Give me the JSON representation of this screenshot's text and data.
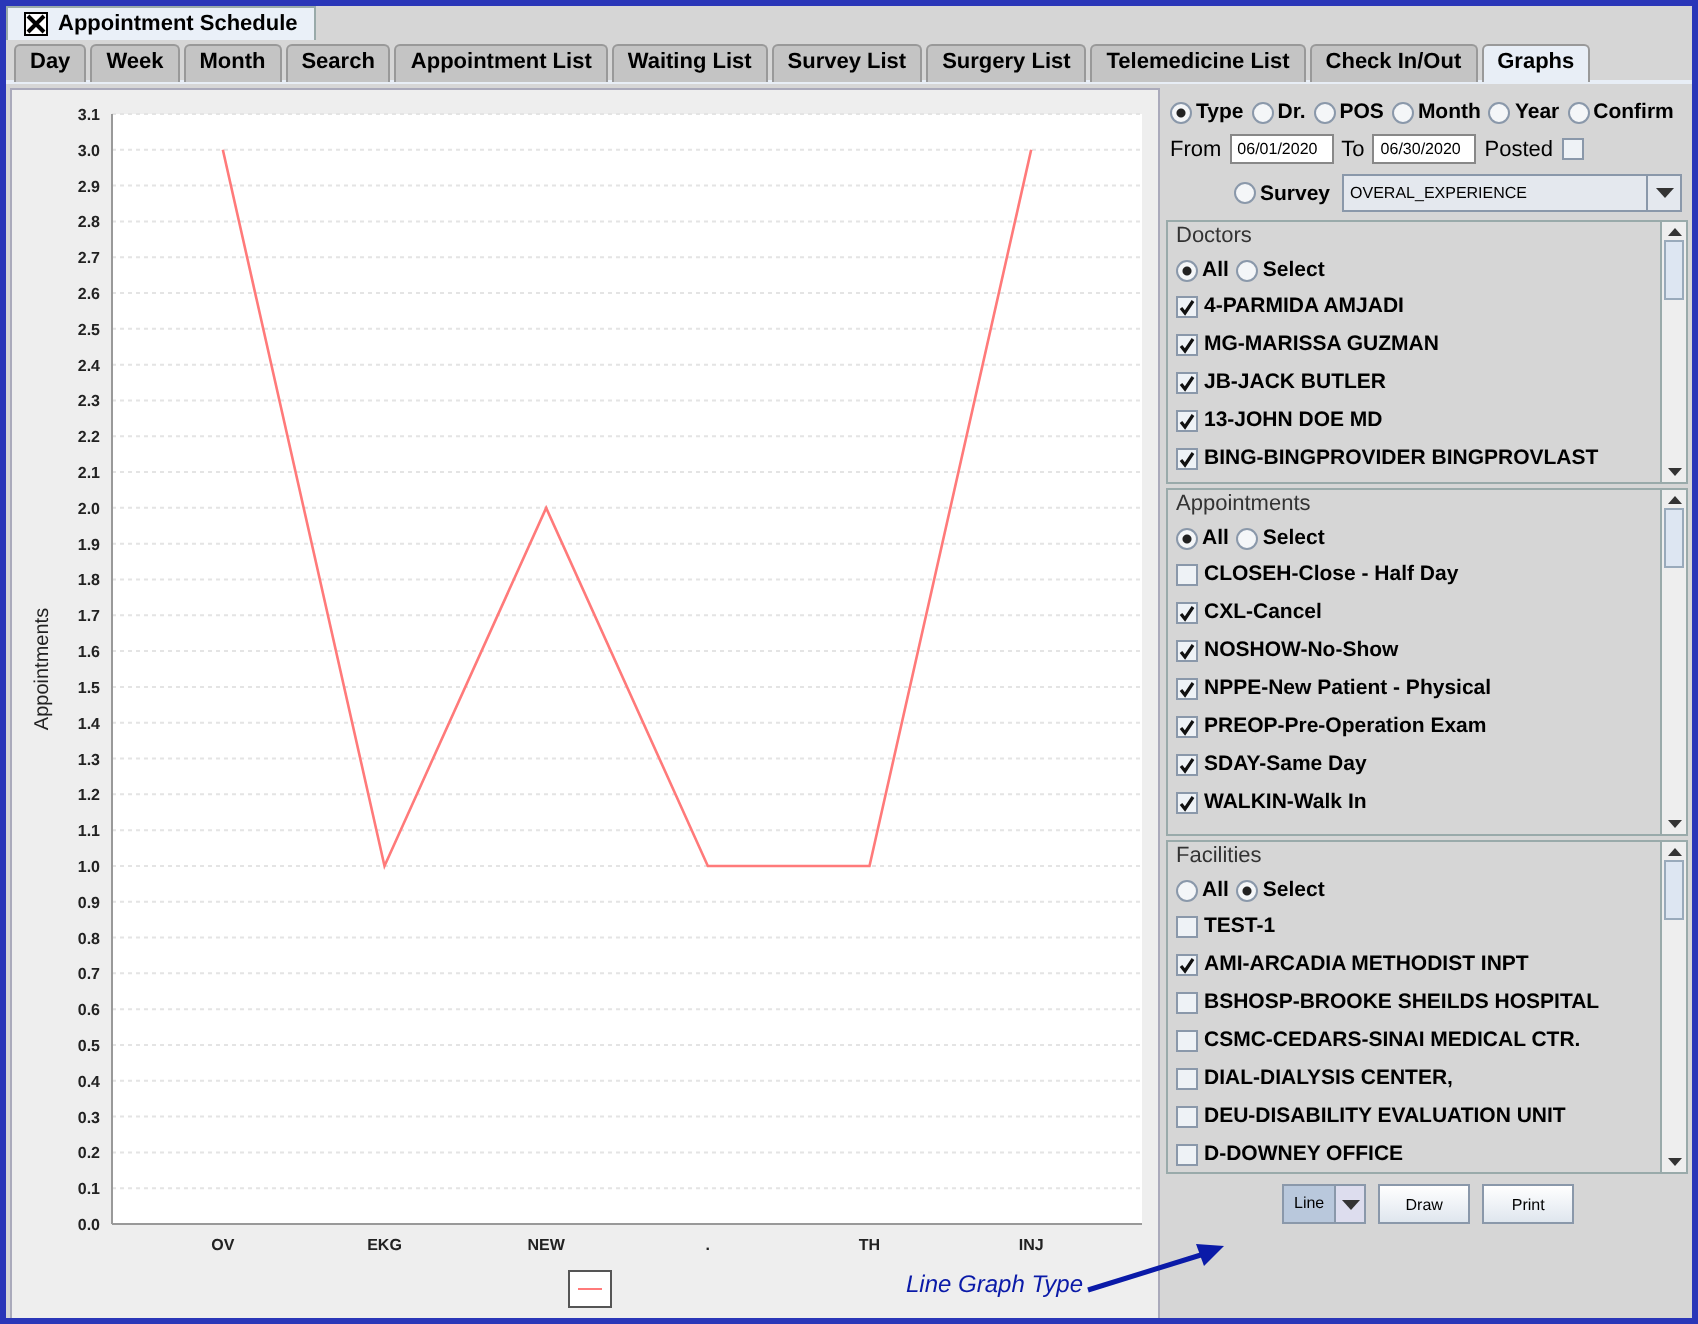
{
  "window": {
    "title": "Appointment Schedule"
  },
  "tabs": [
    {
      "label": "Day",
      "selected": false
    },
    {
      "label": "Week",
      "selected": false
    },
    {
      "label": "Month",
      "selected": false
    },
    {
      "label": "Search",
      "selected": false
    },
    {
      "label": "Appointment List",
      "selected": false
    },
    {
      "label": "Waiting List",
      "selected": false
    },
    {
      "label": "Survey List",
      "selected": false
    },
    {
      "label": "Surgery List",
      "selected": false
    },
    {
      "label": "Telemedicine List",
      "selected": false
    },
    {
      "label": "Check In/Out",
      "selected": false
    },
    {
      "label": "Graphs",
      "selected": true
    }
  ],
  "chart": {
    "chart_data": {
      "type": "line",
      "ylabel": "Appointments",
      "categories": [
        "OV",
        "EKG",
        "NEW",
        ".",
        "TH",
        "INJ"
      ],
      "series": [
        {
          "color": "#ff7a7a",
          "values": [
            3,
            1,
            2,
            1,
            1,
            3
          ]
        }
      ],
      "ylim": [
        0,
        3.1
      ],
      "grid": true,
      "yticks": [
        {
          "value": 0,
          "label": "0.0"
        },
        0.1,
        0.2,
        0.3,
        0.4,
        0.5,
        0.6,
        0.7,
        0.8,
        0.9,
        {
          "value": 1,
          "label": "1.0"
        },
        1.1,
        1.2,
        1.3,
        1.4,
        1.5,
        1.6,
        1.7,
        1.8,
        1.9,
        {
          "value": 2,
          "label": "2.0"
        },
        2.1,
        2.2,
        2.3,
        2.4,
        2.5,
        2.6,
        2.7,
        2.8,
        2.9,
        {
          "value": 3,
          "label": "3.0"
        },
        3.1
      ]
    }
  },
  "controls": {
    "group_by": [
      {
        "label": "Type",
        "selected": true
      },
      {
        "label": "Dr.",
        "selected": false
      },
      {
        "label": "POS",
        "selected": false
      },
      {
        "label": "Month",
        "selected": false
      },
      {
        "label": "Year",
        "selected": false
      },
      {
        "label": "Confirm",
        "selected": false
      }
    ],
    "from_label": "From",
    "from": "06/01/2020",
    "to_label": "To",
    "to": "06/30/2020",
    "posted_label": "Posted",
    "posted": false,
    "survey": {
      "label": "Survey",
      "selected": false,
      "value": "OVERAL_EXPERIENCE"
    }
  },
  "lists": [
    {
      "title": "Doctors",
      "filter": [
        {
          "label": "All",
          "selected": true
        },
        {
          "label": "Select",
          "selected": false
        }
      ],
      "items": [
        {
          "label": "4-PARMIDA AMJADI",
          "checked": true
        },
        {
          "label": "MG-MARISSA GUZMAN",
          "checked": true
        },
        {
          "label": "JB-JACK BUTLER",
          "checked": true
        },
        {
          "label": "13-JOHN DOE MD",
          "checked": true
        },
        {
          "label": "BING-BINGPROVIDER BINGPROVLAST",
          "checked": true
        }
      ]
    },
    {
      "title": "Appointments",
      "filter": [
        {
          "label": "All",
          "selected": true
        },
        {
          "label": "Select",
          "selected": false
        }
      ],
      "items": [
        {
          "label": "CLOSEH-Close - Half Day",
          "checked": false
        },
        {
          "label": "CXL-Cancel",
          "checked": true
        },
        {
          "label": "NOSHOW-No-Show",
          "checked": true
        },
        {
          "label": "NPPE-New Patient - Physical",
          "checked": true
        },
        {
          "label": "PREOP-Pre-Operation Exam",
          "checked": true
        },
        {
          "label": "SDAY-Same Day",
          "checked": true
        },
        {
          "label": "WALKIN-Walk In",
          "checked": true
        }
      ]
    },
    {
      "title": "Facilities",
      "filter": [
        {
          "label": "All",
          "selected": false
        },
        {
          "label": "Select",
          "selected": true
        }
      ],
      "items": [
        {
          "label": "TEST-1",
          "checked": false
        },
        {
          "label": "AMI-ARCADIA METHODIST INPT",
          "checked": true
        },
        {
          "label": "BSHOSP-BROOKE SHEILDS HOSPITAL",
          "checked": false
        },
        {
          "label": "CSMC-CEDARS-SINAI MEDICAL CTR.",
          "checked": false
        },
        {
          "label": "DIAL-DIALYSIS CENTER,",
          "checked": false
        },
        {
          "label": "DEU-DISABILITY EVALUATION UNIT",
          "checked": false
        },
        {
          "label": "D-DOWNEY OFFICE",
          "checked": false
        }
      ]
    }
  ],
  "graph_type": "Line",
  "buttons": [
    "Draw",
    "Print"
  ],
  "annotation": "Line Graph Type"
}
